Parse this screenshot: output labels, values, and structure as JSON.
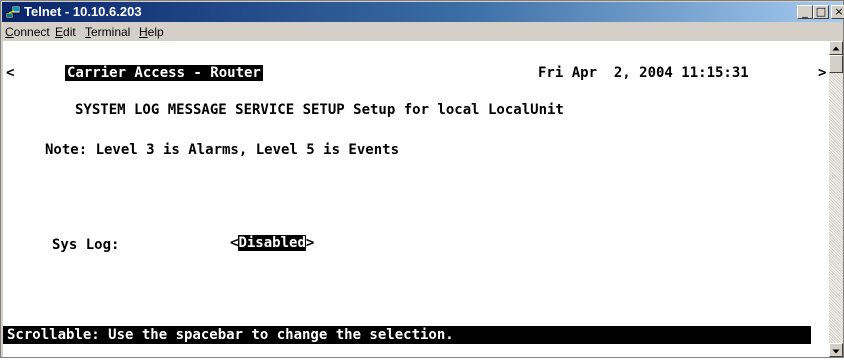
{
  "window": {
    "title": "Telnet - 10.10.6.203",
    "app_icon": "telnet-computer-icon",
    "controls": {
      "minimize": "_",
      "maximize": "□",
      "close": "×"
    }
  },
  "menu": [
    {
      "label": "Connect",
      "accel": "C",
      "rest": "onnect"
    },
    {
      "label": "Edit",
      "accel": "E",
      "rest": "dit"
    },
    {
      "label": "Terminal",
      "accel": "T",
      "rest": "erminal"
    },
    {
      "label": "Help",
      "accel": "H",
      "rest": "elp"
    }
  ],
  "terminal": {
    "left_scroll_marker": "<",
    "right_scroll_marker": ">",
    "header_title": "Carrier Access - Router",
    "datetime": "Fri Apr  2, 2004 11:15:31",
    "screen_title": "SYSTEM LOG MESSAGE SERVICE SETUP Setup for local LocalUnit",
    "note": "Note: Level 3 is Alarms, Level 5 is Events",
    "syslog": {
      "label": "Sys Log:",
      "open_bracket": "<",
      "value": "Disabled",
      "close_bracket": ">"
    },
    "status_message": "Scrollable: Use the spacebar to change the selection."
  },
  "scrollbar": {
    "up_icon": "scroll-up-arrow-icon",
    "down_icon": "scroll-down-arrow-icon"
  }
}
